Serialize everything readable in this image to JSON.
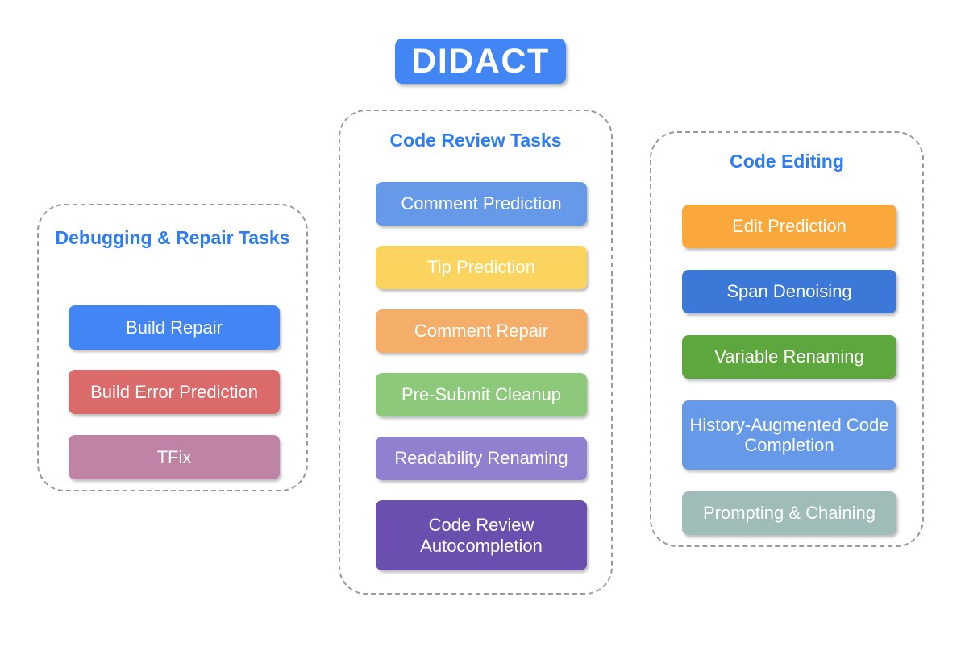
{
  "title": {
    "label": "DIDACT",
    "bg_color": "#4285F4",
    "text_color": "#FFFFFF"
  },
  "groups": [
    {
      "id": "debugging",
      "title": "Debugging & Repair Tasks",
      "title_color": "#2B7CF6",
      "items": [
        {
          "label": "Build Repair",
          "color": "#4285F4"
        },
        {
          "label": "Build Error Prediction",
          "color": "#DB6A6A"
        },
        {
          "label": "TFix",
          "color": "#BF83A6"
        }
      ]
    },
    {
      "id": "review",
      "title": "Code Review Tasks",
      "title_color": "#2B7CF6",
      "items": [
        {
          "label": "Comment Prediction",
          "color": "#6699E8"
        },
        {
          "label": "Tip Prediction",
          "color": "#FBD45F"
        },
        {
          "label": "Comment Repair",
          "color": "#F5AE6A"
        },
        {
          "label": "Pre-Submit Cleanup",
          "color": "#8CC97A"
        },
        {
          "label": "Readability Renaming",
          "color": "#9180CF"
        },
        {
          "label": "Code Review Autocompletion",
          "color": "#6B4FAF"
        }
      ]
    },
    {
      "id": "editing",
      "title": "Code Editing",
      "title_color": "#2B7CF6",
      "items": [
        {
          "label": "Edit Prediction",
          "color": "#FAA73C"
        },
        {
          "label": "Span Denoising",
          "color": "#3B78D8"
        },
        {
          "label": "Variable Renaming",
          "color": "#5EA63E"
        },
        {
          "label": "History-Augmented Code Completion",
          "color": "#6699E8"
        },
        {
          "label": "Prompting & Chaining",
          "color": "#9FBCB9"
        }
      ]
    }
  ]
}
